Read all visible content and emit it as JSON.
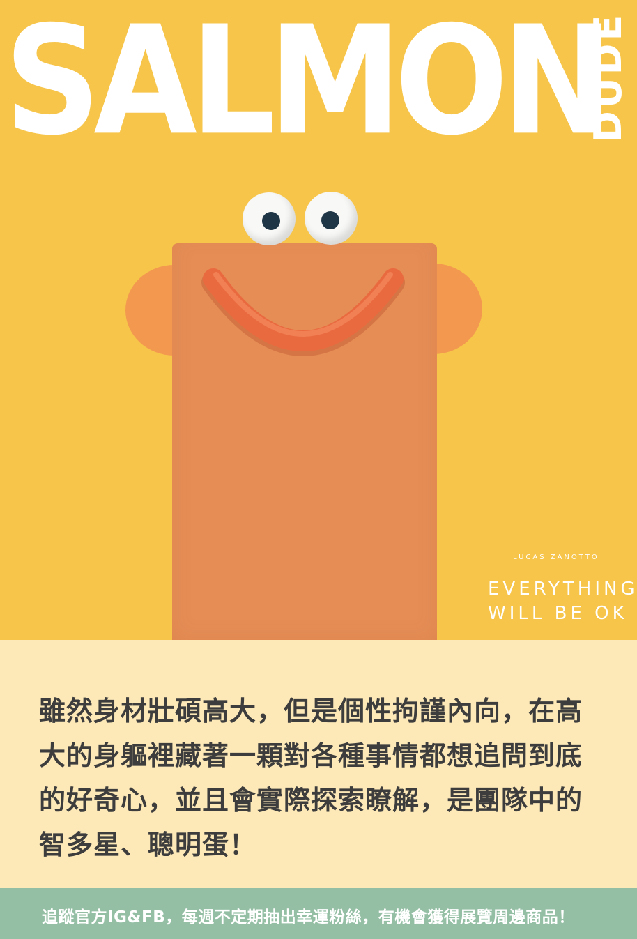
{
  "poster": {
    "title": "SALMON",
    "title_vertical": "DUDE",
    "artist": "LUCAS ZANOTTO",
    "tagline_line1": "EVERYTHING",
    "tagline_line2": "WILL BE OK"
  },
  "character": {
    "eyes": [
      "eye-icon",
      "eye-icon"
    ],
    "mouth": "smile-icon",
    "colors": {
      "background": "#f6c54a",
      "body": "#e58d55",
      "ears": "#f3984f",
      "mouth": "#ea6a3f",
      "pupil": "#1f3646"
    }
  },
  "description": {
    "text": "雖然身材壯碩高大，但是個性拘謹內向，在高大的身軀裡藏著一顆對各種事情都想追問到底的好奇心，並且會實際探索瞭解，是團隊中的智多星、聰明蛋！",
    "panel_color": "#fde9b8"
  },
  "footer": {
    "text": "追蹤官方IG&FB，每週不定期抽出幸運粉絲，有機會獲得展覽周邊商品！",
    "bar_color": "#94bfa5"
  }
}
